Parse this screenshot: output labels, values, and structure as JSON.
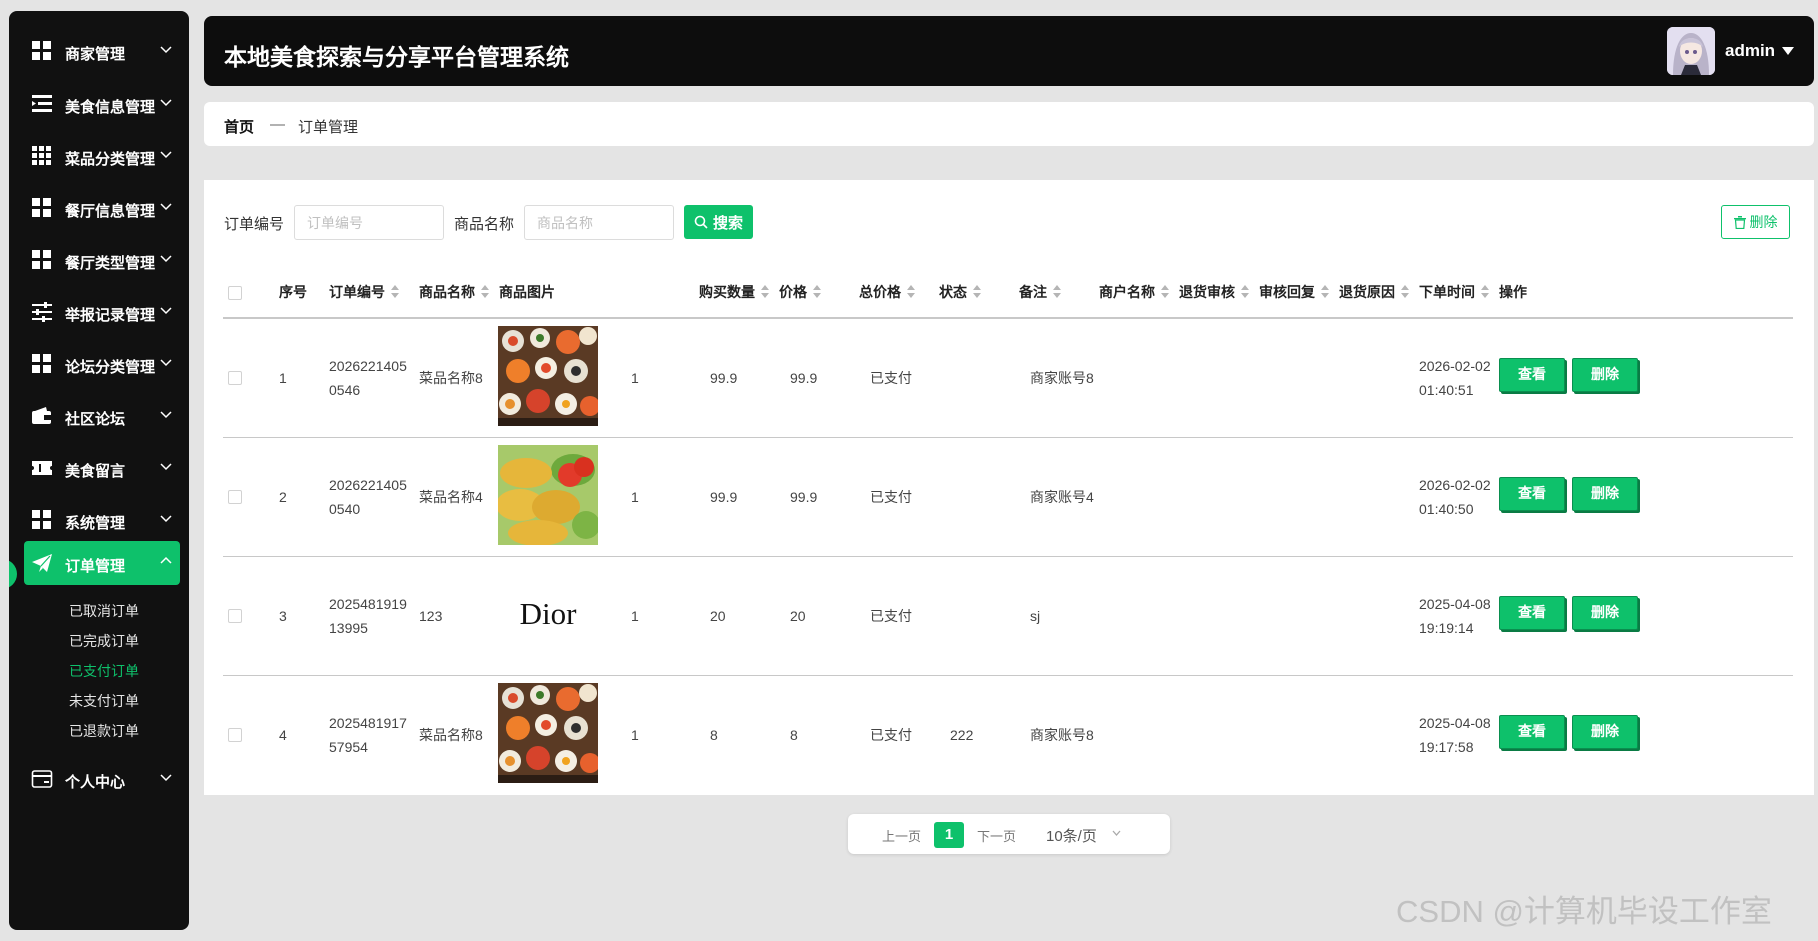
{
  "sidebar": {
    "items": [
      {
        "label": "商家管理",
        "icon": "grid-icon"
      },
      {
        "label": "美食信息管理",
        "icon": "list-indent-icon"
      },
      {
        "label": "菜品分类管理",
        "icon": "grid-nine-icon"
      },
      {
        "label": "餐厅信息管理",
        "icon": "grid-icon"
      },
      {
        "label": "餐厅类型管理",
        "icon": "grid-icon"
      },
      {
        "label": "举报记录管理",
        "icon": "sliders-icon"
      },
      {
        "label": "论坛分类管理",
        "icon": "grid-icon"
      },
      {
        "label": "社区论坛",
        "icon": "wallet-icon"
      },
      {
        "label": "美食留言",
        "icon": "ticket-icon"
      },
      {
        "label": "系统管理",
        "icon": "grid-icon"
      },
      {
        "label": "订单管理",
        "icon": "paper-plane-icon"
      },
      {
        "label": "个人中心",
        "icon": "card-icon"
      }
    ],
    "order_sub": [
      {
        "label": "已取消订单"
      },
      {
        "label": "已完成订单"
      },
      {
        "label": "已支付订单"
      },
      {
        "label": "未支付订单"
      },
      {
        "label": "已退款订单"
      }
    ]
  },
  "header": {
    "title": "本地美食探索与分享平台管理系统",
    "user": "admin"
  },
  "breadcrumb": {
    "home": "首页",
    "separator": "—",
    "current": "订单管理"
  },
  "filters": {
    "order_no_label": "订单编号",
    "order_no_placeholder": "订单编号",
    "goods_name_label": "商品名称",
    "goods_name_placeholder": "商品名称",
    "search_label": "搜索",
    "bulk_delete_label": "删除"
  },
  "table": {
    "columns": [
      "序号",
      "订单编号",
      "商品名称",
      "商品图片",
      "购买数量",
      "价格",
      "总价格",
      "状态",
      "备注",
      "商户名称",
      "退货审核",
      "审核回复",
      "退货原因",
      "下单时间",
      "操作"
    ],
    "rows": [
      {
        "index": "1",
        "order_no": "20262214050546",
        "goods": "菜品名称8",
        "image": "sushi",
        "qty": "1",
        "price": "99.9",
        "total": "99.9",
        "status": "已支付",
        "remark": "",
        "merchant": "商家账号8",
        "return_audit": "",
        "audit_reply": "",
        "return_reason": "",
        "time": "2026-02-02 01:40:51"
      },
      {
        "index": "2",
        "order_no": "20262214050540",
        "goods": "菜品名称4",
        "image": "dumplings",
        "qty": "1",
        "price": "99.9",
        "total": "99.9",
        "status": "已支付",
        "remark": "",
        "merchant": "商家账号4",
        "return_audit": "",
        "audit_reply": "",
        "return_reason": "",
        "time": "2026-02-02 01:40:50"
      },
      {
        "index": "3",
        "order_no": "202548191913995",
        "goods": "123",
        "image": "Dior",
        "qty": "1",
        "price": "20",
        "total": "20",
        "status": "已支付",
        "remark": "",
        "merchant": "sj",
        "return_audit": "",
        "audit_reply": "",
        "return_reason": "",
        "time": "2025-04-08 19:19:14"
      },
      {
        "index": "4",
        "order_no": "202548191757954",
        "goods": "菜品名称8",
        "image": "sushi",
        "qty": "1",
        "price": "8",
        "total": "8",
        "status": "已支付",
        "remark": "222",
        "merchant": "商家账号8",
        "return_audit": "",
        "audit_reply": "",
        "return_reason": "",
        "time": "2025-04-08 19:17:58"
      }
    ],
    "view_label": "查看",
    "delete_label": "删除"
  },
  "pagination": {
    "prev": "上一页",
    "current": "1",
    "next": "下一页",
    "page_size": "10条/页"
  },
  "watermark": "CSDN @计算机毕设工作室",
  "colors": {
    "accent": "#0ec16b",
    "sidebar_bg": "#111111",
    "header_bg": "#0d0d0d"
  }
}
